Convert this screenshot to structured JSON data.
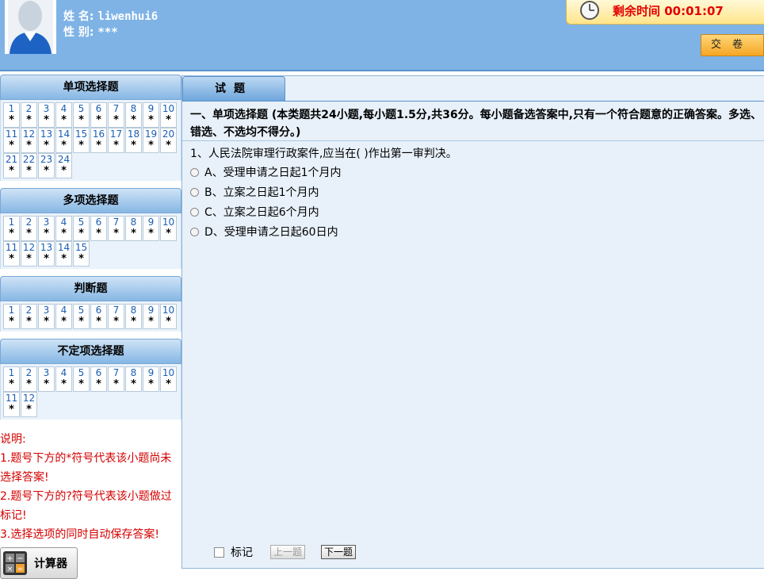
{
  "header": {
    "name_label": "姓  名:",
    "name_value": "liwenhui6",
    "gender_label": "性  别:",
    "gender_value": "***",
    "timer_text": "剩余时间 00:01:07",
    "submit_label": "交卷"
  },
  "sidebar": {
    "sections": [
      {
        "title": "单项选择题",
        "count": 24
      },
      {
        "title": "多项选择题",
        "count": 15
      },
      {
        "title": "判断题",
        "count": 10
      },
      {
        "title": "不定项选择题",
        "count": 12
      }
    ],
    "unanswered_mark": "*",
    "notes": [
      "说明:",
      "1.题号下方的*符号代表该小题尚未",
      "选择答案!",
      "2.题号下方的?符号代表该小题做过",
      "标记!",
      "3.选择选项的同时自动保存答案!"
    ],
    "calculator_label": "计算器"
  },
  "main": {
    "tab_label": "试题",
    "section_title": "一、单项选择题 (本类题共24小题,每小题1.5分,共36分。每小题备选答案中,只有一个符合题意的正确答案。多选、错选、不选均不得分。)",
    "question": "1、人民法院审理行政案件,应当在(     )作出第一审判决。",
    "options": [
      "A、受理申请之日起1个月内",
      "B、立案之日起1个月内",
      "C、立案之日起6个月内",
      "D、受理申请之日起60日内"
    ],
    "mark_label": "标记",
    "prev_label": "上一题",
    "next_label": "下一题"
  },
  "colors": {
    "header_bg": "#7fb3e6",
    "timer_text": "#e30000",
    "notes_text": "#d40000",
    "number_text": "#1a5fb4"
  }
}
